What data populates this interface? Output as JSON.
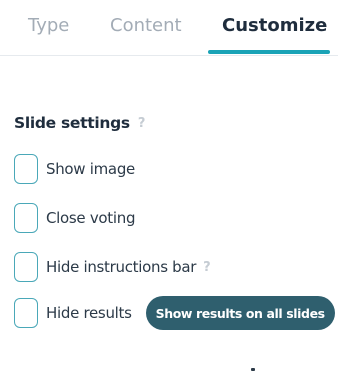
{
  "tabs": [
    {
      "label": "Type",
      "active": false
    },
    {
      "label": "Content",
      "active": false
    },
    {
      "label": "Customize",
      "active": true
    }
  ],
  "slide_settings": {
    "title": "Slide settings",
    "help_glyph": "?",
    "options": [
      {
        "label": "Show image",
        "checked": false
      },
      {
        "label": "Close voting",
        "checked": false
      },
      {
        "label": "Hide instructions bar",
        "checked": false,
        "help_glyph": "?"
      },
      {
        "label": "Hide results",
        "checked": false
      }
    ],
    "show_results_button": "Show results on all slides"
  },
  "colors": {
    "accent": "#1aa3b6",
    "checkbox_border": "#4aa8b8",
    "pill_bg": "#2f5f6e",
    "inactive_tab": "#a3acb6",
    "text": "#1f2d3d"
  }
}
